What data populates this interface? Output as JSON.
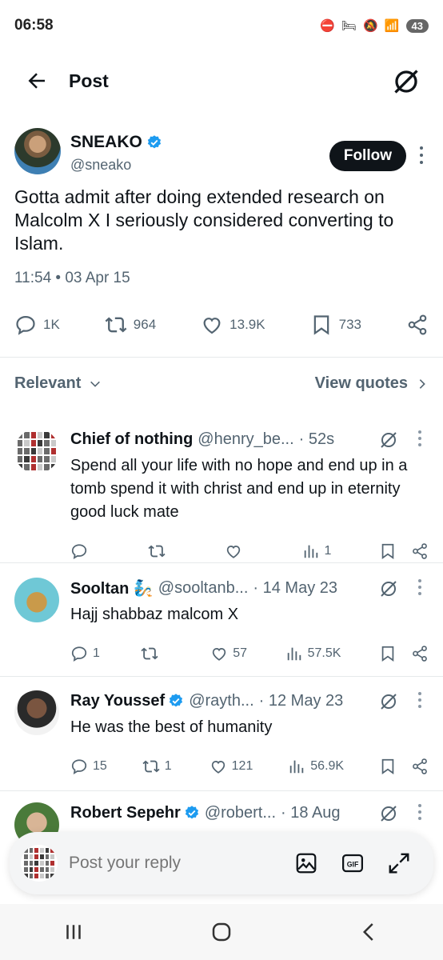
{
  "status_bar": {
    "time": "06:58",
    "battery": "43"
  },
  "header": {
    "title": "Post"
  },
  "tweet": {
    "author_name": "SNEAKO",
    "author_handle": "@sneako",
    "follow_label": "Follow",
    "text": "Gotta admit after doing extended research on Malcolm X I seriously considered converting to Islam.",
    "timestamp": "11:54 • 03 Apr 15",
    "replies": "1K",
    "reposts": "964",
    "likes": "13.9K",
    "bookmarks": "733"
  },
  "sort": {
    "label": "Relevant",
    "view_quotes": "View quotes"
  },
  "replies": [
    {
      "name": "Chief of nothing",
      "handle": "@henry_be...",
      "time": "· 52s",
      "text": "Spend all your life with no hope and end up in a tomb spend it with christ and end up in eternity good luck mate",
      "replies": "",
      "reposts": "",
      "likes": "",
      "views": "1"
    },
    {
      "name": "Sooltan 🧞",
      "handle": "@sooltanb...",
      "time": "· 14 May 23",
      "text": "Hajj  shabbaz malcom X",
      "replies": "1",
      "reposts": "",
      "likes": "57",
      "views": "57.5K"
    },
    {
      "name": "Ray Youssef",
      "handle": "@rayth...",
      "time": "· 12 May 23",
      "text": "He was the best of humanity",
      "replies": "15",
      "reposts": "1",
      "likes": "121",
      "views": "56.9K"
    },
    {
      "name": "Robert Sepehr",
      "handle": "@robert...",
      "time": "· 18 Aug",
      "text": "",
      "replies": "",
      "reposts": "",
      "likes": "",
      "views": ""
    }
  ],
  "composer": {
    "placeholder": "Post your reply"
  },
  "colors": {
    "text": "#0f1419",
    "muted": "#536471",
    "verified": "#1d9bf0",
    "divider": "#e6e9eb"
  }
}
